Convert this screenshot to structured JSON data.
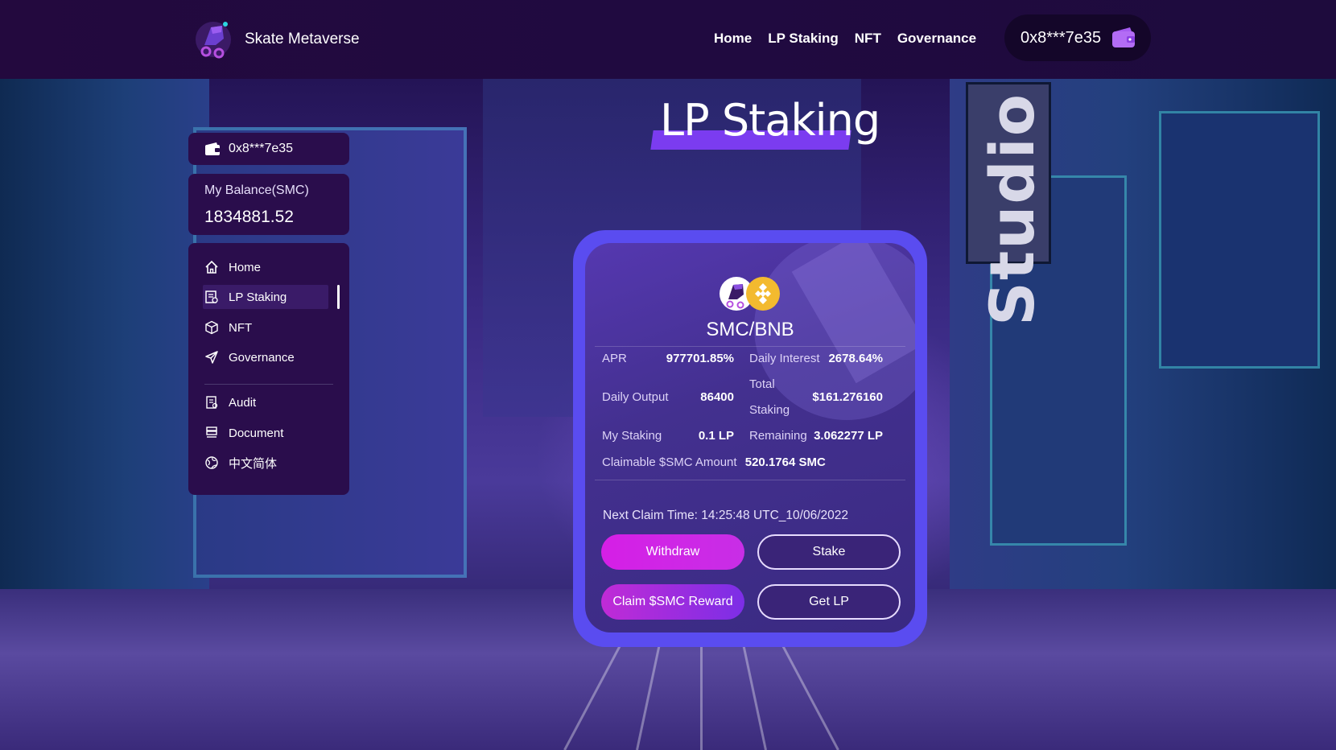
{
  "brand": {
    "name": "Skate Metaverse"
  },
  "nav": [
    "Home",
    "LP Staking",
    "NFT",
    "Governance"
  ],
  "wallet": {
    "address": "0x8***7e35"
  },
  "background": {
    "sign_text": "Studio"
  },
  "sidebar": {
    "wallet_address": "0x8***7e35",
    "balance_label": "My Balance(SMC)",
    "balance_value": "1834881.52",
    "items": [
      {
        "label": "Home",
        "icon": "home-icon"
      },
      {
        "label": "LP Staking",
        "icon": "staking-icon",
        "active": true
      },
      {
        "label": "NFT",
        "icon": "cube-icon"
      },
      {
        "label": "Governance",
        "icon": "send-icon"
      },
      {
        "label": "Audit",
        "icon": "audit-icon"
      },
      {
        "label": "Document",
        "icon": "document-icon"
      },
      {
        "label": "中文简体",
        "icon": "language-icon"
      }
    ]
  },
  "page": {
    "title": "LP Staking"
  },
  "card": {
    "pair": "SMC/BNB",
    "stats": {
      "apr_label": "APR",
      "apr_value": "977701.85%",
      "daily_interest_label": "Daily Interest",
      "daily_interest_value": "2678.64%",
      "daily_output_label": "Daily Output",
      "daily_output_value": "86400",
      "total_staking_label_1": "Total",
      "total_staking_label_2": "Staking",
      "total_staking_value": "$161.276160",
      "my_staking_label": "My Staking",
      "my_staking_value": "0.1 LP",
      "remaining_label": "Remaining",
      "remaining_value": "3.062277 LP",
      "claimable_label": "Claimable $SMC Amount",
      "claimable_value": "520.1764 SMC"
    },
    "next_claim": "Next Claim Time: 14:25:48 UTC_10/06/2022",
    "buttons": {
      "withdraw": "Withdraw",
      "stake": "Stake",
      "claim": "Claim $SMC Reward",
      "get_lp": "Get LP"
    }
  },
  "colors": {
    "accent": "#7b3cf0",
    "card_border": "#5a4cf0",
    "button_pink": "#d51fe6"
  }
}
